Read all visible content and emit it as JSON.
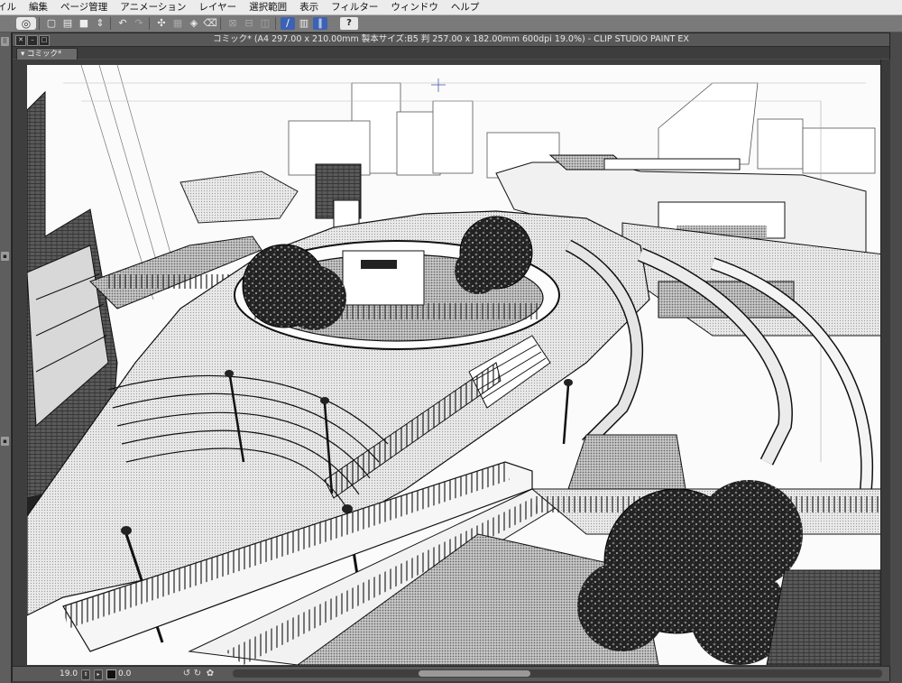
{
  "menu": {
    "items": [
      "イル",
      "編集",
      "ページ管理",
      "アニメーション",
      "レイヤー",
      "選択範囲",
      "表示",
      "フィルター",
      "ウィンドウ",
      "ヘルプ"
    ]
  },
  "toolbar": {
    "icons": [
      "clip-studio-logo-icon",
      "new-file-icon",
      "open-file-icon",
      "save-icon",
      "save-options-icon",
      "undo-icon",
      "redo-icon",
      "transform-icon",
      "select-all-icon",
      "fill-icon",
      "clear-icon",
      "crop-icon",
      "deselect-icon",
      "invert-selection-icon",
      "snap-ruler-icon",
      "snap-grid-icon",
      "snap-special-icon",
      "help-icon"
    ],
    "help_label": "?"
  },
  "window": {
    "title": "コミック* (A4 297.00 x 210.00mm 製本サイズ:B5 判 257.00 x 182.00mm 600dpi 19.0%)  - CLIP STUDIO PAINT EX",
    "tab_label": "コミック*"
  },
  "status": {
    "zoom": "19.0",
    "angle": "0.0"
  },
  "colors": {
    "accent": "#3c62b4",
    "paper": "#fafafa",
    "chrome": "#4d4d4d"
  }
}
